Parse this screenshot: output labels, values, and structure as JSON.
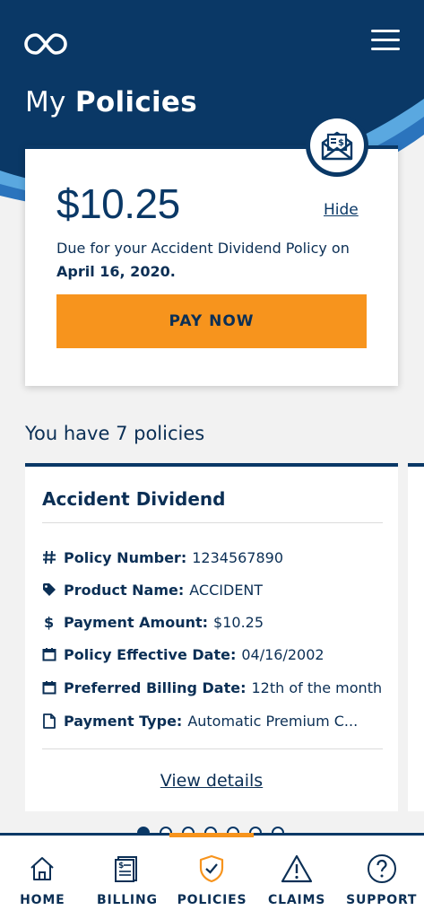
{
  "header": {
    "title_light": "My",
    "title_bold": "Policies",
    "logo_icon": "infinity-logo-icon",
    "menu_icon": "hamburger-menu-icon"
  },
  "payment_due": {
    "amount": "$10.25",
    "hide_label": "Hide",
    "due_prefix": "Due for your Accident Dividend Policy on ",
    "due_date": "April 16, 2020.",
    "pay_button": "PAY NOW",
    "icon": "envelope-bill-icon"
  },
  "policies_count_text": "You have 7 policies",
  "policy_card": {
    "name": "Accident Dividend",
    "details": [
      {
        "icon": "hash-icon",
        "label": "Policy Number:",
        "value": "1234567890"
      },
      {
        "icon": "tag-icon",
        "label": "Product Name:",
        "value": "ACCIDENT"
      },
      {
        "icon": "dollar-icon",
        "label": "Payment Amount:",
        "value": "$10.25"
      },
      {
        "icon": "calendar-icon",
        "label": "Policy Effective Date:",
        "value": "04/16/2002"
      },
      {
        "icon": "calendar-icon",
        "label": "Preferred Billing Date:",
        "value": "12th of the month"
      },
      {
        "icon": "document-icon",
        "label": "Payment Type:",
        "value": "Automatic Premium C..."
      }
    ],
    "view_details": "View details"
  },
  "pager": {
    "total": 7,
    "active_index": 0
  },
  "bottom_nav": [
    {
      "label": "HOME",
      "icon": "home-icon"
    },
    {
      "label": "BILLING",
      "icon": "bill-icon"
    },
    {
      "label": "POLICIES",
      "icon": "shield-check-icon",
      "active": true
    },
    {
      "label": "CLAIMS",
      "icon": "warning-icon"
    },
    {
      "label": "SUPPORT",
      "icon": "question-icon"
    }
  ],
  "colors": {
    "navy": "#0a3866",
    "text": "#0b2f55",
    "accent": "#f7941d",
    "wave_light": "#5aa8e0",
    "wave_mid": "#2b74bd"
  }
}
